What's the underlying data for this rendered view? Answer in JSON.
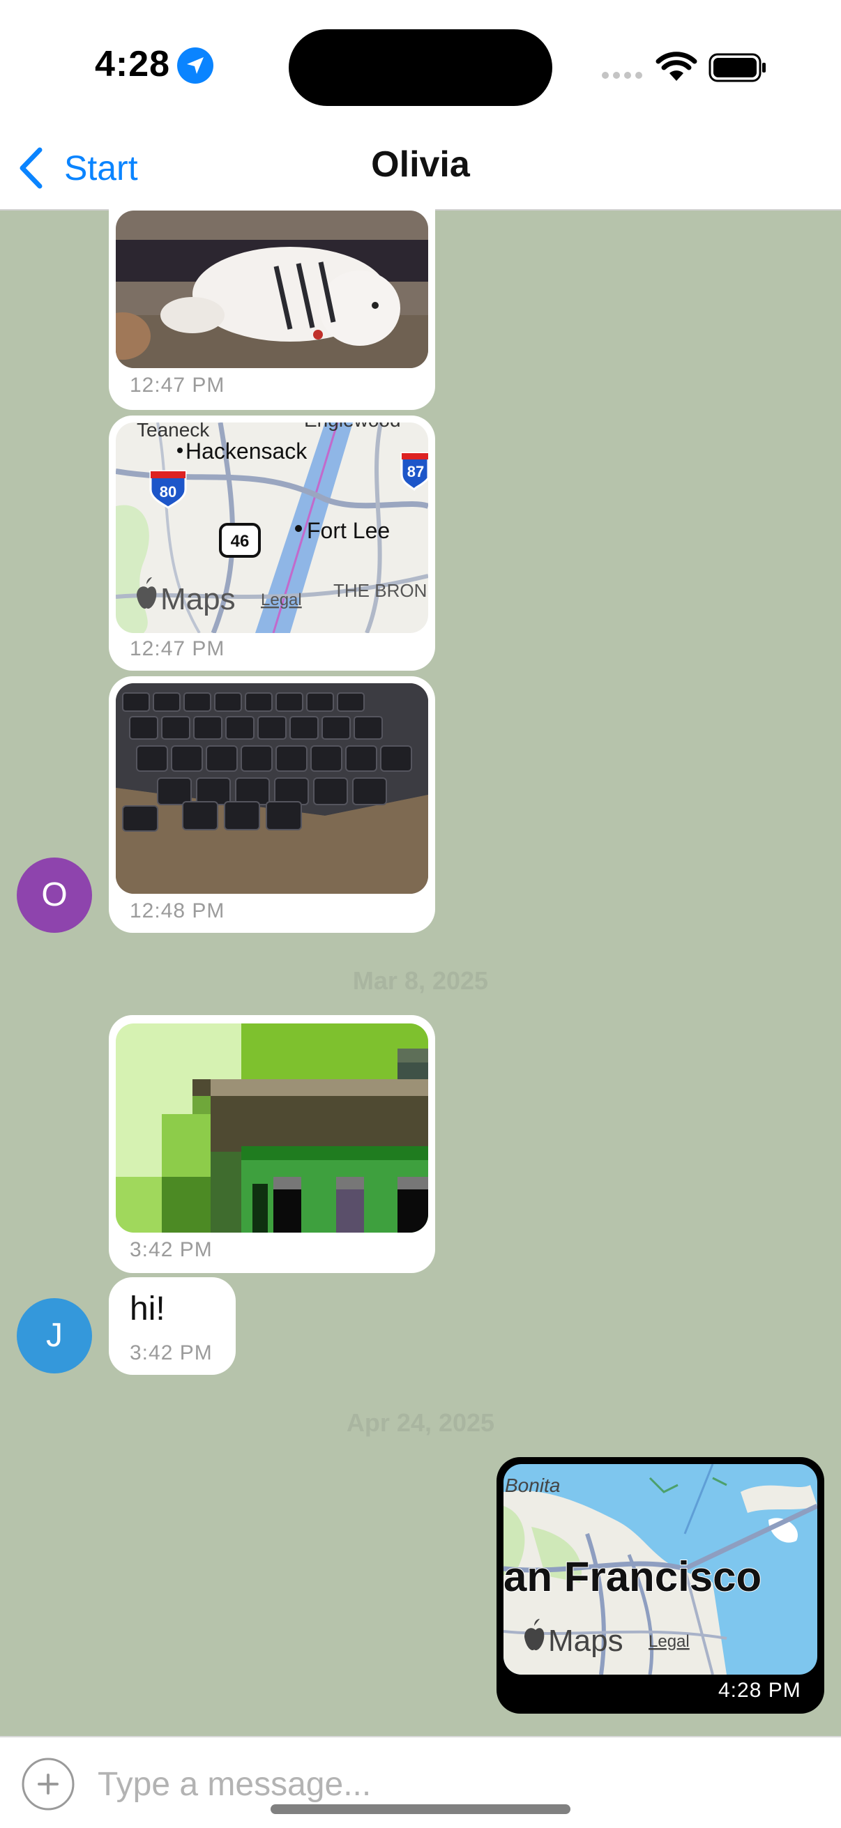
{
  "status_bar": {
    "time": "4:28"
  },
  "nav": {
    "back_label": "Start",
    "title": "Olivia"
  },
  "messages": [
    {
      "kind": "image",
      "subject": "white fluffy dog",
      "timestamp": "12:47 PM"
    },
    {
      "kind": "map",
      "place_labels": [
        "Teaneck",
        "Englewood",
        "Hackensack",
        "Fort Lee",
        "THE BRON"
      ],
      "route_shields": [
        "80",
        "87",
        "46"
      ],
      "attribution": "Maps",
      "legal": "Legal",
      "timestamp": "12:47 PM"
    },
    {
      "kind": "image",
      "subject": "laptop keyboard",
      "timestamp": "12:48 PM"
    },
    {
      "kind": "image",
      "subject": "pixel art",
      "timestamp": "3:42 PM"
    },
    {
      "kind": "text",
      "text": "hi!",
      "timestamp": "3:42 PM"
    },
    {
      "kind": "map",
      "place_labels": [
        "Bonita",
        "an Francisco"
      ],
      "attribution": "Maps",
      "legal": "Legal",
      "timestamp": "4:28 PM"
    }
  ],
  "avatars": [
    {
      "initial": "O",
      "color": "#8e44ad"
    },
    {
      "initial": "J",
      "color": "#3498db"
    }
  ],
  "date_separators": [
    "Mar 8, 2025",
    "Apr 24, 2025"
  ],
  "input": {
    "placeholder": "Type a message..."
  },
  "colors": {
    "background": "#b6c3ab",
    "accent": "#0a84ff",
    "outgoing_bubble": "#000000",
    "incoming_bubble": "#ffffff"
  }
}
